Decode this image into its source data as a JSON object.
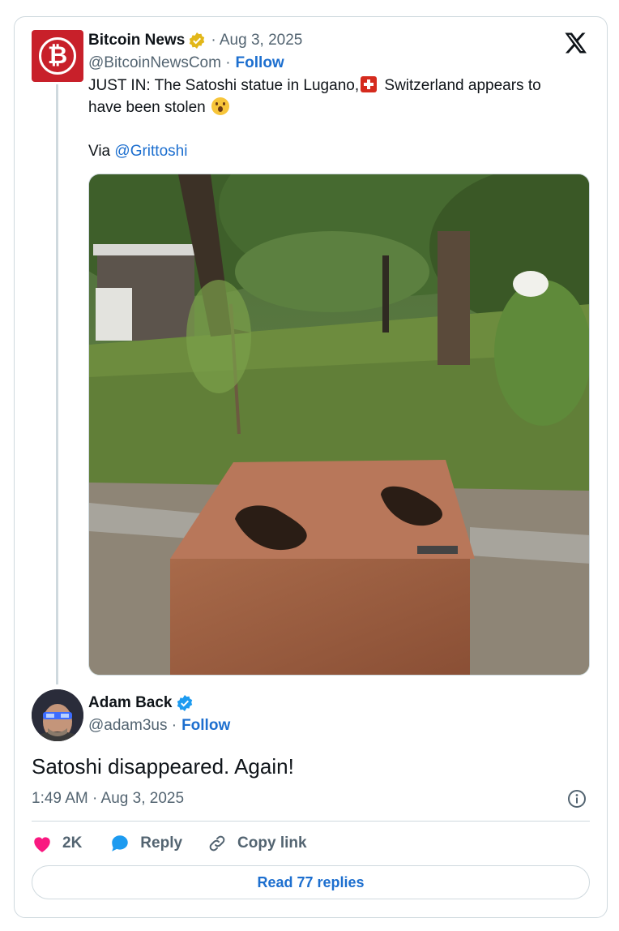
{
  "quoted": {
    "author_name": "Bitcoin News",
    "date": "· Aug 3, 2025",
    "handle": "@BitcoinNewsCom ·",
    "follow_label": "Follow",
    "text_part1": "JUST IN: The Satoshi statue in Lugano,",
    "text_part2": "Switzerland appears to",
    "text_line2": "have been stolen",
    "via_label": "Via",
    "via_mention": "@Grittoshi"
  },
  "main": {
    "author_name": "Adam Back",
    "handle": "@adam3us ·",
    "follow_label": "Follow",
    "text": "Satoshi disappeared. Again!",
    "timestamp": "1:49 AM · Aug 3, 2025"
  },
  "actions": {
    "like_count": "2K",
    "reply_label": "Reply",
    "copy_label": "Copy link"
  },
  "read_replies_label": "Read 77 replies",
  "colors": {
    "brand_blue": "#1d6fcf",
    "like_pink": "#f91880",
    "muted": "#536471",
    "border": "#cfd9de",
    "bitcoin_red": "#c8202a",
    "gold_badge": "#e2b719",
    "verified_blue": "#1d9bf0"
  },
  "icons": [
    "x-logo-icon",
    "gold-verified-badge-icon",
    "blue-verified-badge-icon",
    "swiss-flag-icon",
    "surprised-face-icon",
    "info-icon",
    "heart-icon",
    "reply-bubble-icon",
    "link-icon"
  ]
}
